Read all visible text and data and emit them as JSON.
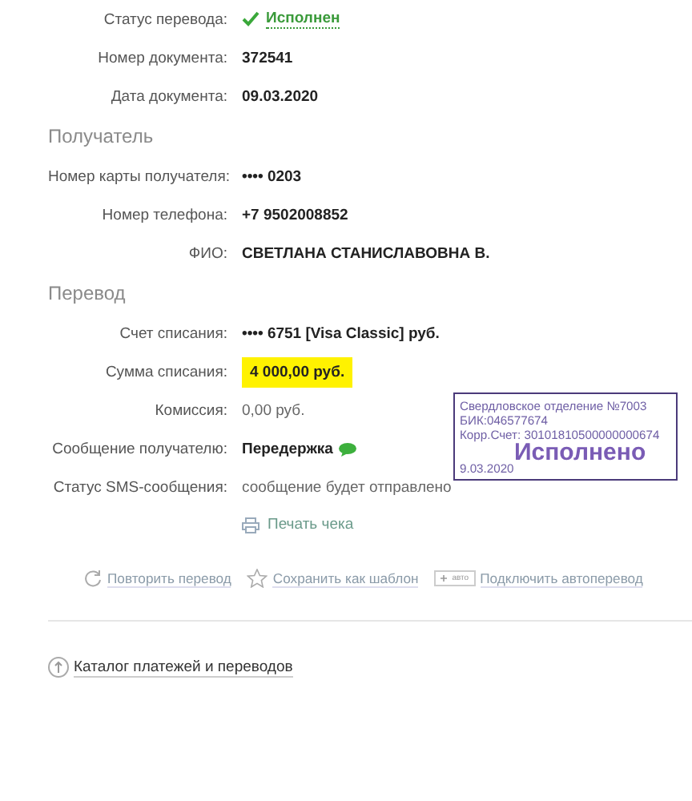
{
  "sections": [
    {
      "rows": [
        {
          "label": "Статус перевода:",
          "value": "Исполнен",
          "kind": "status"
        },
        {
          "label": "Номер документа:",
          "value": "372541",
          "kind": "bold"
        },
        {
          "label": "Дата документа:",
          "value": "09.03.2020",
          "kind": "bold"
        }
      ]
    },
    {
      "title": "Получатель",
      "rows": [
        {
          "label": "Номер карты получателя:",
          "value": "•••• 0203",
          "kind": "bold"
        },
        {
          "label": "Номер телефона:",
          "value": "+7 9502008852",
          "kind": "bold"
        },
        {
          "label": "ФИО:",
          "value": "СВЕТЛАНА СТАНИСЛАВОВНА В.",
          "kind": "bold"
        }
      ]
    },
    {
      "title": "Перевод",
      "rows": [
        {
          "label": "Счет списания:",
          "value": "•••• 6751  [Visa Classic]  руб.",
          "kind": "bold"
        },
        {
          "label": "Сумма списания:",
          "value": "4 000,00  руб.",
          "kind": "highlight"
        },
        {
          "label": "Комиссия:",
          "value": "0,00 руб.",
          "kind": "plain"
        },
        {
          "label": "Сообщение получателю:",
          "value": "Передержка",
          "kind": "message"
        },
        {
          "label": "Статус SMS-сообщения:",
          "value": "сообщение будет отправлено",
          "kind": "plain"
        }
      ]
    }
  ],
  "print_link": "Печать чека",
  "actions": [
    {
      "label": "Повторить перевод",
      "kind": "repeat"
    },
    {
      "label": "Сохранить как шаблон",
      "kind": "star"
    },
    {
      "label": "Подключить автоперевод",
      "kind": "auto",
      "badge": "авто"
    }
  ],
  "catalog_link": "Каталог платежей и переводов",
  "stamp": {
    "lines": [
      "Свердловское отделение №7003",
      "БИК:046577674",
      "Корр.Счет: 30101810500000000674"
    ],
    "status": "Исполнено",
    "date": "9.03.2020"
  }
}
